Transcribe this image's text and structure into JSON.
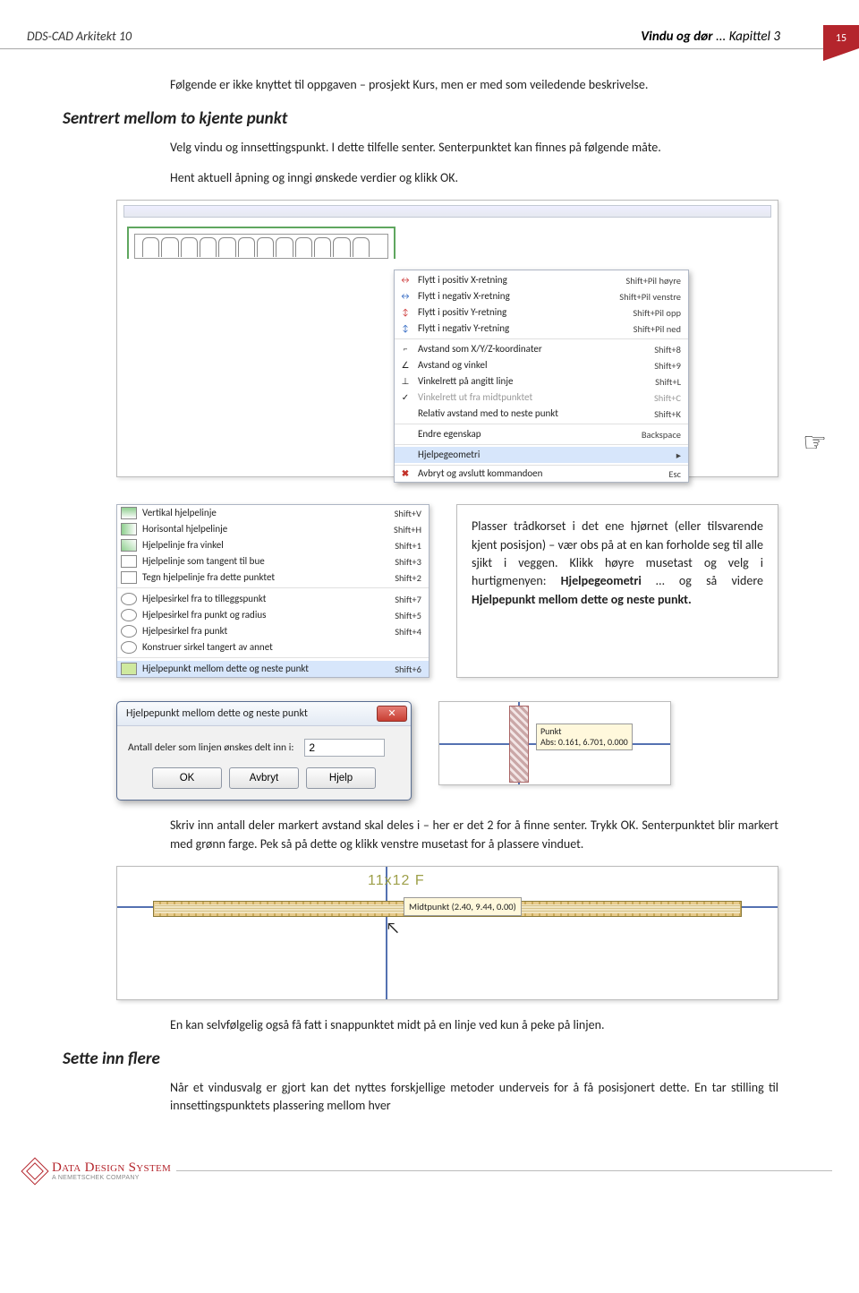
{
  "header": {
    "left": "DDS-CAD Arkitekt 10",
    "right_bold": "Vindu og dør",
    "right_light": " ... Kapittel 3",
    "page_number": "15"
  },
  "body": {
    "intro": "Følgende er ikke knyttet til oppgaven – prosjekt Kurs, men er med som veiledende beskrivelse.",
    "section1": {
      "heading": "Sentrert mellom to kjente punkt",
      "p1": "Velg vindu og innsettingspunkt. I dette tilfelle senter. Senterpunktet kan finnes på følgende måte.",
      "p2": "Hent aktuell åpning og inngi ønskede verdier og klikk OK."
    },
    "textbox": {
      "part1": "Plasser trådkorset i det ene hjørnet (eller tilsvarende kjent posisjon) – vær obs på at en kan forholde seg til alle sjikt i veggen. Klikk høyre musetast og velg i hurtigmenyen:\n",
      "bold1": "Hjelpegeometri",
      "part2": " … og så videre ",
      "bold2": "Hjelpepunkt mellom dette og neste punkt."
    },
    "after_dialog": "Skriv inn antall deler markert avstand skal deles i – her er det 2 for å finne senter. Trykk OK. Senterpunktet blir markert med grønn farge. Pek så på dette og klikk venstre musetast for å plassere vinduet.",
    "snap_line": "En kan selvfølgelig også få fatt i snappunktet midt på en linje ved kun å peke på linjen.",
    "section2": {
      "heading": "Sette inn flere",
      "p1": "Når et vindusvalg er gjort kan det nyttes forskjellige metoder underveis for å få posisjonert dette. En tar stilling til innsettingspunktets plassering mellom hver"
    }
  },
  "ctx": {
    "grp1": [
      {
        "label": "Flytt i positiv X-retning",
        "shortcut": "Shift+Pil høyre"
      },
      {
        "label": "Flytt i negativ X-retning",
        "shortcut": "Shift+Pil venstre"
      },
      {
        "label": "Flytt i positiv Y-retning",
        "shortcut": "Shift+Pil opp"
      },
      {
        "label": "Flytt i negativ Y-retning",
        "shortcut": "Shift+Pil ned"
      }
    ],
    "grp2": [
      {
        "label": "Avstand som X/Y/Z-koordinater",
        "shortcut": "Shift+8"
      },
      {
        "label": "Avstand og vinkel",
        "shortcut": "Shift+9"
      },
      {
        "label": "Vinkelrett på angitt linje",
        "shortcut": "Shift+L"
      },
      {
        "label": "Vinkelrett ut fra midtpunktet",
        "shortcut": "Shift+C"
      },
      {
        "label": "Relativ avstand med to neste punkt",
        "shortcut": "Shift+K"
      }
    ],
    "grp3": [
      {
        "label": "Endre egenskap",
        "shortcut": "Backspace"
      }
    ],
    "grp4": [
      {
        "label": "Hjelpegeometri",
        "shortcut": ""
      }
    ],
    "grp5": [
      {
        "label": "Avbryt og avslutt kommandoen",
        "shortcut": "Esc"
      }
    ]
  },
  "sub": {
    "items": [
      {
        "label": "Vertikal hjelpelinje",
        "shortcut": "Shift+V"
      },
      {
        "label": "Horisontal hjelpelinje",
        "shortcut": "Shift+H"
      },
      {
        "label": "Hjelpelinje fra vinkel",
        "shortcut": "Shift+1"
      },
      {
        "label": "Hjelpelinje som tangent til bue",
        "shortcut": "Shift+3"
      },
      {
        "label": "Tegn hjelpelinje fra dette punktet",
        "shortcut": "Shift+2"
      },
      {
        "label": "Hjelpesirkel fra to  tilleggspunkt",
        "shortcut": "Shift+7"
      },
      {
        "label": "Hjelpesirkel fra punkt og radius",
        "shortcut": "Shift+5"
      },
      {
        "label": "Hjelpesirkel fra punkt",
        "shortcut": "Shift+4"
      },
      {
        "label": "Konstruer sirkel tangert av annet",
        "shortcut": ""
      },
      {
        "label": "Hjelpepunkt mellom dette og neste punkt",
        "shortcut": "Shift+6"
      }
    ]
  },
  "dialog": {
    "title": "Hjelpepunkt mellom dette og neste punkt",
    "label": "Antall deler som linjen ønskes delt inn i:",
    "value": "2",
    "ok": "OK",
    "cancel": "Avbryt",
    "help": "Hjelp"
  },
  "snap": {
    "title": "Punkt",
    "coords": "Abs: 0.161, 6.701, 0.000"
  },
  "shot4": {
    "dim": "11x12 F",
    "tooltip": "Midtpunkt (2.40, 9.44, 0.00)"
  },
  "footer": {
    "brand": "Data Design System",
    "sub": "A NEMETSCHEK COMPANY"
  }
}
